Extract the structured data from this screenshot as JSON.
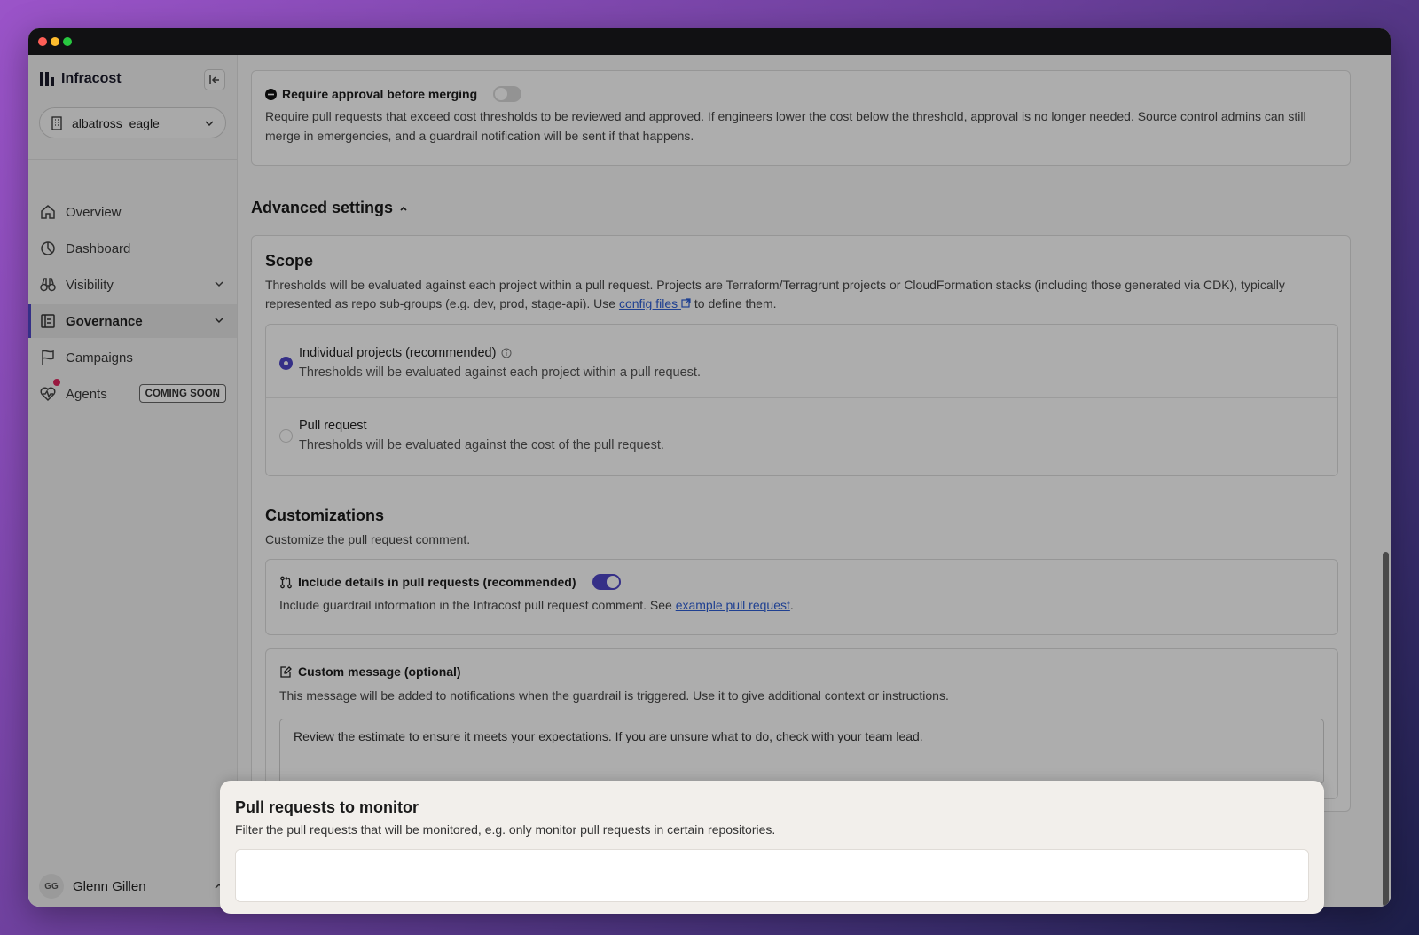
{
  "sidebar": {
    "brand": "Infracost",
    "org": "albatross_eagle",
    "nav": [
      {
        "label": "Overview",
        "icon": "home-icon"
      },
      {
        "label": "Dashboard",
        "icon": "pie-chart-icon"
      },
      {
        "label": "Visibility",
        "icon": "binoculars-icon"
      },
      {
        "label": "Governance",
        "icon": "clipboard-icon"
      },
      {
        "label": "Campaigns",
        "icon": "flag-icon"
      },
      {
        "label": "Agents",
        "icon": "heart-pulse-icon"
      }
    ],
    "agents_badge": "COMING SOON",
    "user": {
      "initials": "GG",
      "name": "Glenn Gillen"
    }
  },
  "approval": {
    "title": "Require approval before merging",
    "enabled": false,
    "description": "Require pull requests that exceed cost thresholds to be reviewed and approved. If engineers lower the cost below the threshold, approval is no longer needed. Source control admins can still merge in emergencies, and a guardrail notification will be sent if that happens."
  },
  "advanced_heading": "Advanced settings",
  "scope": {
    "title": "Scope",
    "description_pre": "Thresholds will be evaluated against each project within a pull request. Projects are Terraform/Terragrunt projects or CloudFormation stacks (including those generated via CDK), typically represented as repo sub-groups (e.g. dev, prod, stage-api). Use ",
    "link": "config files",
    "description_post": " to define them.",
    "options": [
      {
        "label": "Individual projects (recommended)",
        "description": "Thresholds will be evaluated against each project within a pull request.",
        "selected": true
      },
      {
        "label": "Pull request",
        "description": "Thresholds will be evaluated against the cost of the pull request.",
        "selected": false
      }
    ]
  },
  "customizations": {
    "title": "Customizations",
    "description": "Customize the pull request comment.",
    "include_details": {
      "title": "Include details in pull requests (recommended)",
      "enabled": true,
      "description_pre": "Include guardrail information in the Infracost pull request comment. See ",
      "link": "example pull request",
      "description_post": "."
    },
    "custom_message": {
      "title": "Custom message (optional)",
      "description": "This message will be added to notifications when the guardrail is triggered. Use it to give additional context or instructions.",
      "value": "Review the estimate to ensure it meets your expectations. If you are unsure what to do, check with your team lead."
    }
  },
  "monitor": {
    "title": "Pull requests to monitor",
    "description": "Filter the pull requests that will be monitored, e.g. only monitor pull requests in certain repositories."
  },
  "colors": {
    "accent": "#4f46c8",
    "link": "#2e5fd6"
  }
}
